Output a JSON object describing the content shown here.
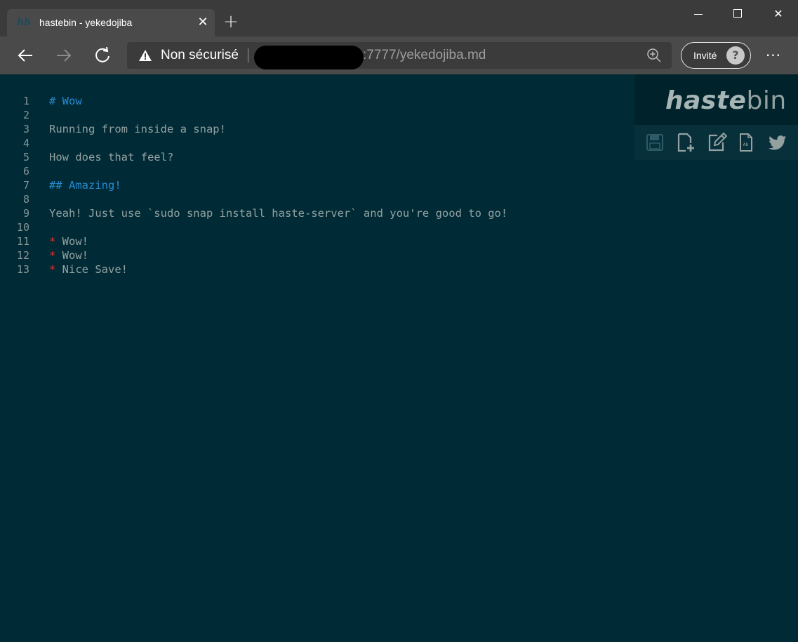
{
  "browser": {
    "tab": {
      "title": "hastebin - yekedojiba",
      "favicon": "hb"
    },
    "address": {
      "security_label": "Non sécurisé",
      "url_visible": ":7777/yekedojiba.md"
    },
    "profile": {
      "label": "Invité"
    },
    "icons": {
      "back": "arrow-left-icon",
      "forward": "arrow-right-icon",
      "reload": "reload-icon",
      "warning": "warning-icon",
      "zoom": "zoom-in-icon",
      "more": "more-icon"
    }
  },
  "editor": {
    "line_numbers": [
      "1",
      "2",
      "3",
      "4",
      "5",
      "6",
      "7",
      "8",
      "9",
      "10",
      "11",
      "12",
      "13"
    ],
    "lines": [
      {
        "prefix": "",
        "text": "# Wow",
        "style": "heading"
      },
      {
        "prefix": "",
        "text": "",
        "style": "plain"
      },
      {
        "prefix": "",
        "text": "Running from inside a snap!",
        "style": "plain"
      },
      {
        "prefix": "",
        "text": "",
        "style": "plain"
      },
      {
        "prefix": "",
        "text": "How does that feel?",
        "style": "plain"
      },
      {
        "prefix": "",
        "text": "",
        "style": "plain"
      },
      {
        "prefix": "",
        "text": "## Amazing!",
        "style": "heading"
      },
      {
        "prefix": "",
        "text": "",
        "style": "plain"
      },
      {
        "prefix": "",
        "text": "Yeah! Just use `sudo snap install haste-server` and you're good to go!",
        "style": "plain"
      },
      {
        "prefix": "",
        "text": "",
        "style": "plain"
      },
      {
        "prefix": "*",
        "text": " Wow!",
        "style": "bullet"
      },
      {
        "prefix": "*",
        "text": " Wow!",
        "style": "bullet"
      },
      {
        "prefix": "*",
        "text": " Nice Save!",
        "style": "bullet"
      }
    ]
  },
  "hastebin": {
    "logo_bold": "haste",
    "logo_thin": "bin",
    "buttons": [
      "save-icon",
      "new-icon",
      "duplicate-edit-icon",
      "raw-icon",
      "twitter-icon"
    ]
  },
  "colors": {
    "background": "#002b36",
    "text": "#93a1a1",
    "heading": "#268bd2",
    "bullet": "#dc322f"
  }
}
